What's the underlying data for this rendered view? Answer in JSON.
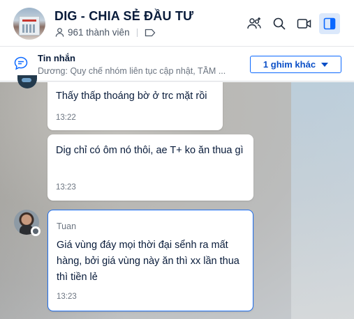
{
  "header": {
    "group_name": "DIG - CHIA SẺ ĐẦU TƯ",
    "member_count": "961 thành viên",
    "icons": [
      "add-member-icon",
      "search-icon",
      "video-call-icon",
      "sidebar-toggle-icon"
    ],
    "accent_color": "#0b68ff"
  },
  "pinned": {
    "title": "Tin nhắn",
    "preview": "Dương: Quy chế nhóm liên tục cập nhật,  TẦM ...",
    "more_label": "1 ghim khác"
  },
  "messages": [
    {
      "text": "Thấy thấp thoáng bờ ở trc mặt rồi",
      "time": "13:22"
    },
    {
      "text": "Dig chỉ có ôm nó thôi, ae T+ ko ăn thua gì",
      "time": "13:23"
    },
    {
      "sender": "Tuan",
      "text": "Giá vùng đáy mọi thời đại sểnh ra mất hàng, bởi giá vùng này ăn thì xx lần thua thì tiền lẻ",
      "time": "13:23"
    }
  ]
}
